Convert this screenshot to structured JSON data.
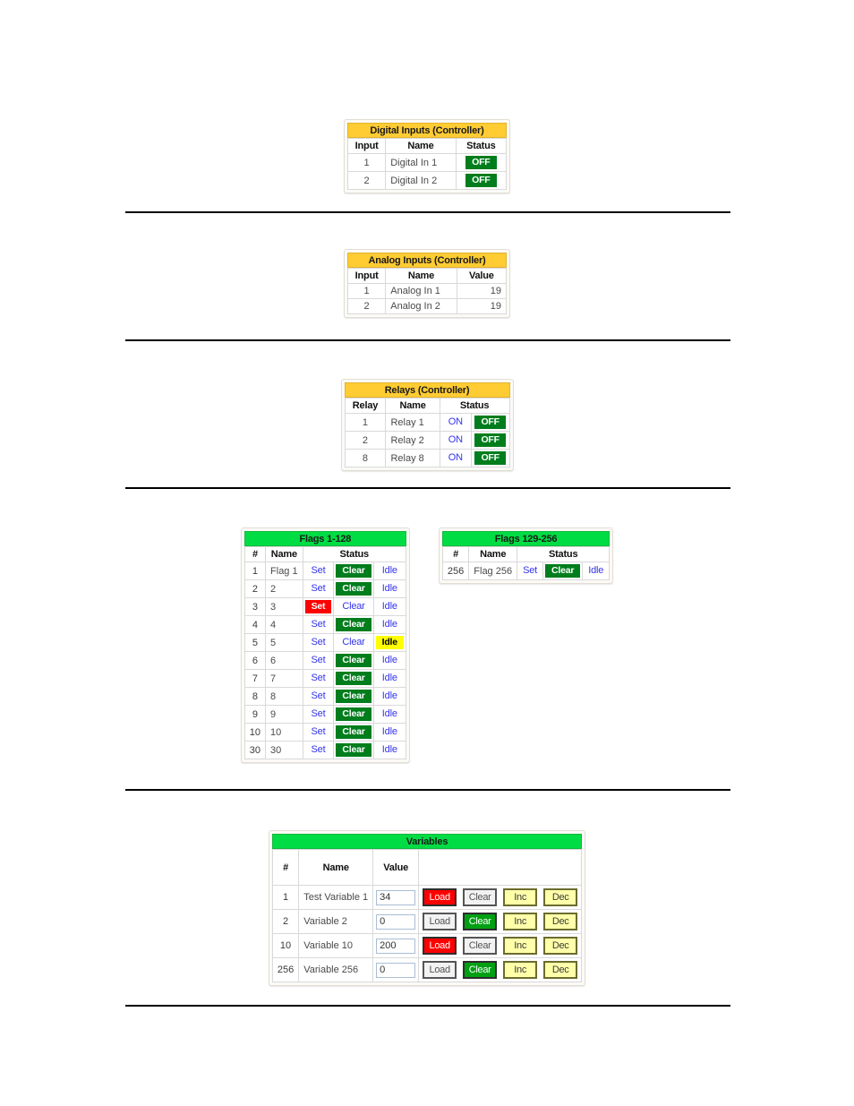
{
  "digital_inputs": {
    "title": "Digital Inputs (Controller)",
    "headers": [
      "Input",
      "Name",
      "Status"
    ],
    "rows": [
      {
        "input": "1",
        "name": "Digital In 1",
        "status": "OFF"
      },
      {
        "input": "2",
        "name": "Digital In 2",
        "status": "OFF"
      }
    ]
  },
  "analog_inputs": {
    "title": "Analog Inputs (Controller)",
    "headers": [
      "Input",
      "Name",
      "Value"
    ],
    "rows": [
      {
        "input": "1",
        "name": "Analog In 1",
        "value": "19"
      },
      {
        "input": "2",
        "name": "Analog In 2",
        "value": "19"
      }
    ]
  },
  "relays": {
    "title": "Relays (Controller)",
    "headers": [
      "Relay",
      "Name",
      "Status"
    ],
    "on_label": "ON",
    "off_label": "OFF",
    "rows": [
      {
        "relay": "1",
        "name": "Relay 1",
        "on": "ON",
        "off": "OFF"
      },
      {
        "relay": "2",
        "name": "Relay 2",
        "on": "ON",
        "off": "OFF"
      },
      {
        "relay": "8",
        "name": "Relay 8",
        "on": "ON",
        "off": "OFF"
      }
    ]
  },
  "flags_low": {
    "title": "Flags 1-128",
    "headers": [
      "#",
      "Name",
      "Status"
    ],
    "rows": [
      {
        "num": "1",
        "name": "Flag 1",
        "set": "Set",
        "clear": "Clear",
        "idle": "Idle",
        "active": "clear"
      },
      {
        "num": "2",
        "name": "2",
        "set": "Set",
        "clear": "Clear",
        "idle": "Idle",
        "active": "clear"
      },
      {
        "num": "3",
        "name": "3",
        "set": "Set",
        "clear": "Clear",
        "idle": "Idle",
        "active": "set"
      },
      {
        "num": "4",
        "name": "4",
        "set": "Set",
        "clear": "Clear",
        "idle": "Idle",
        "active": "clear"
      },
      {
        "num": "5",
        "name": "5",
        "set": "Set",
        "clear": "Clear",
        "idle": "Idle",
        "active": "idle"
      },
      {
        "num": "6",
        "name": "6",
        "set": "Set",
        "clear": "Clear",
        "idle": "Idle",
        "active": "clear"
      },
      {
        "num": "7",
        "name": "7",
        "set": "Set",
        "clear": "Clear",
        "idle": "Idle",
        "active": "clear"
      },
      {
        "num": "8",
        "name": "8",
        "set": "Set",
        "clear": "Clear",
        "idle": "Idle",
        "active": "clear"
      },
      {
        "num": "9",
        "name": "9",
        "set": "Set",
        "clear": "Clear",
        "idle": "Idle",
        "active": "clear"
      },
      {
        "num": "10",
        "name": "10",
        "set": "Set",
        "clear": "Clear",
        "idle": "Idle",
        "active": "clear"
      },
      {
        "num": "30",
        "name": "30",
        "set": "Set",
        "clear": "Clear",
        "idle": "Idle",
        "active": "clear"
      }
    ]
  },
  "flags_high": {
    "title": "Flags 129-256",
    "headers": [
      "#",
      "Name",
      "Status"
    ],
    "rows": [
      {
        "num": "256",
        "name": "Flag 256",
        "set": "Set",
        "clear": "Clear",
        "idle": "Idle",
        "active": "clear"
      }
    ]
  },
  "variables": {
    "title": "Variables",
    "headers": [
      "#",
      "Name",
      "Value",
      ""
    ],
    "buttons": {
      "load": "Load",
      "clear": "Clear",
      "inc": "Inc",
      "dec": "Dec"
    },
    "rows": [
      {
        "num": "1",
        "name": "Test Variable 1",
        "value": "34",
        "active": "load"
      },
      {
        "num": "2",
        "name": "Variable 2",
        "value": "0",
        "active": "clear"
      },
      {
        "num": "10",
        "name": "Variable 10",
        "value": "200",
        "active": "load"
      },
      {
        "num": "256",
        "name": "Variable 256",
        "value": "0",
        "active": "clear"
      }
    ]
  },
  "colors": {
    "amber_header": "#FFCC33",
    "green_header": "#00DD44",
    "status_green": "#007D1C",
    "active_red": "#FF0000",
    "active_yellow": "#FFFF00",
    "link_blue": "#3333EE",
    "button_yellow": "#FFFFAA"
  }
}
